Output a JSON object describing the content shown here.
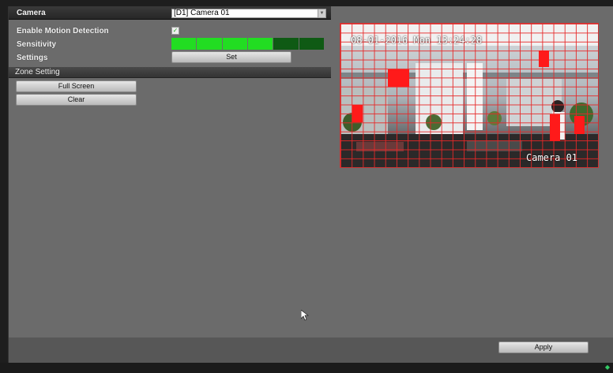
{
  "header": {
    "camera_label": "Camera",
    "camera_value": "[D1] Camera 01"
  },
  "settings": {
    "enable_label": "Enable Motion Detection",
    "enable_checked": true,
    "sensitivity_label": "Sensitivity",
    "sensitivity_level": 4,
    "sensitivity_max": 6,
    "sensitivity_colors": {
      "active": "#22dd22",
      "inactive": "#0f5a14"
    },
    "settings_label": "Settings",
    "set_button": "Set"
  },
  "zone": {
    "title": "Zone Setting",
    "full_screen_button": "Full Screen",
    "clear_button": "Clear"
  },
  "preview": {
    "osd_datetime": "08-01-2016 Mon 13:24:28",
    "osd_camera": "Camera 01",
    "grid_color": "#e62828",
    "zone_fill": "#ff1a1a"
  },
  "footer": {
    "apply_button": "Apply"
  }
}
